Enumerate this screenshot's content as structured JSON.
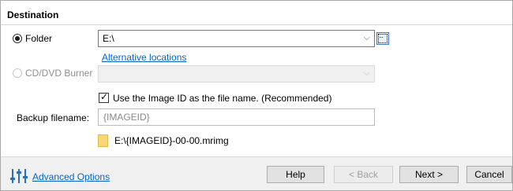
{
  "section": {
    "title": "Destination"
  },
  "folder": {
    "radio_label": "Folder",
    "selected": true,
    "value": "E:\\",
    "browse_icon": "ellipsis-browse-icon",
    "alt_link": "Alternative locations"
  },
  "cd_dvd": {
    "radio_label": "CD/DVD Burner",
    "value": "",
    "enabled": false
  },
  "image_id": {
    "checkbox_label": "Use the Image ID as the file name.  (Recommended)",
    "checked": true
  },
  "backup": {
    "label": "Backup filename:",
    "placeholder": "{IMAGEID}"
  },
  "preview": {
    "icon": "folder-icon",
    "path": "E:\\{IMAGEID}-00-00.mrimg"
  },
  "footer": {
    "advanced_icon": "sliders-icon",
    "advanced_link": "Advanced Options",
    "help": "Help",
    "back": "< Back",
    "next": "Next >",
    "cancel": "Cancel"
  },
  "colors": {
    "link": "#0066cc",
    "bar": "#f0f0f0",
    "folder": "#f7d776"
  }
}
